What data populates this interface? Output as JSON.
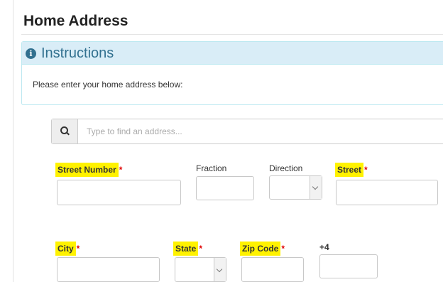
{
  "page": {
    "title": "Home Address"
  },
  "instructions": {
    "icon": "info-circle-icon",
    "title": "Instructions",
    "text": "Please enter your home address below:"
  },
  "search": {
    "icon": "search-icon",
    "placeholder": "Type to find an address..."
  },
  "fields": {
    "street_number": {
      "label": "Street Number",
      "required_mark": "*"
    },
    "fraction": {
      "label": "Fraction"
    },
    "direction": {
      "label": "Direction"
    },
    "street": {
      "label": "Street",
      "required_mark": "*"
    },
    "city": {
      "label": "City",
      "required_mark": "*"
    },
    "state": {
      "label": "State",
      "required_mark": "*"
    },
    "zip": {
      "label": "Zip Code",
      "required_mark": "*"
    },
    "plus4": {
      "label": "+4"
    }
  },
  "colors": {
    "highlight": "#fff200",
    "required": "#e00000",
    "info_bg": "#d9edf7",
    "info_text": "#31708f"
  }
}
